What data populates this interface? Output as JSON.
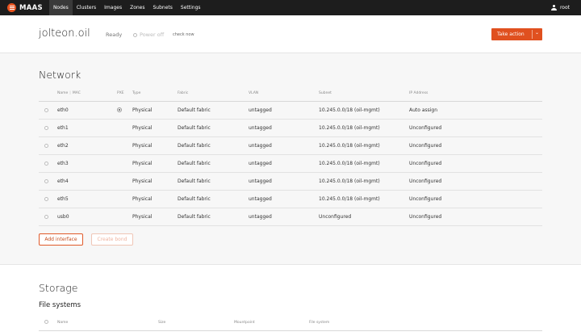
{
  "app": {
    "brand": "MAAS",
    "nav": [
      "Nodes",
      "Clusters",
      "Images",
      "Zones",
      "Subnets",
      "Settings"
    ],
    "active_nav": "Nodes",
    "user": "root"
  },
  "node": {
    "title": "jolteon.oil",
    "status": "Ready",
    "power": "Power off",
    "check_now": "check now",
    "take_action": "Take action"
  },
  "network": {
    "title": "Network",
    "headers": {
      "name": "Name",
      "mac": "MAC",
      "pxe": "PXE",
      "type": "Type",
      "fabric": "Fabric",
      "vlan": "VLAN",
      "subnet": "Subnet",
      "ip": "IP Address"
    },
    "rows": [
      {
        "name": "eth0",
        "pxe": true,
        "type": "Physical",
        "fabric": "Default fabric",
        "vlan": "untagged",
        "subnet": "10.245.0.0/18 (oil-mgmt)",
        "ip": "Auto assign"
      },
      {
        "name": "eth1",
        "pxe": false,
        "type": "Physical",
        "fabric": "Default fabric",
        "vlan": "untagged",
        "subnet": "10.245.0.0/18 (oil-mgmt)",
        "ip": "Unconfigured"
      },
      {
        "name": "eth2",
        "pxe": false,
        "type": "Physical",
        "fabric": "Default fabric",
        "vlan": "untagged",
        "subnet": "10.245.0.0/18 (oil-mgmt)",
        "ip": "Unconfigured"
      },
      {
        "name": "eth3",
        "pxe": false,
        "type": "Physical",
        "fabric": "Default fabric",
        "vlan": "untagged",
        "subnet": "10.245.0.0/18 (oil-mgmt)",
        "ip": "Unconfigured"
      },
      {
        "name": "eth4",
        "pxe": false,
        "type": "Physical",
        "fabric": "Default fabric",
        "vlan": "untagged",
        "subnet": "10.245.0.0/18 (oil-mgmt)",
        "ip": "Unconfigured"
      },
      {
        "name": "eth5",
        "pxe": false,
        "type": "Physical",
        "fabric": "Default fabric",
        "vlan": "untagged",
        "subnet": "10.245.0.0/18 (oil-mgmt)",
        "ip": "Unconfigured"
      },
      {
        "name": "usb0",
        "pxe": false,
        "type": "Physical",
        "fabric": "Default fabric",
        "vlan": "untagged",
        "subnet": "Unconfigured",
        "ip": "Unconfigured"
      }
    ],
    "add_interface": "Add interface",
    "create_bond": "Create bond"
  },
  "storage": {
    "title": "Storage",
    "fs_title": "File systems",
    "headers": {
      "name": "Name",
      "size": "Size",
      "mountpoint": "Mountpoint",
      "filesystem": "File system"
    }
  },
  "colors": {
    "accent": "#e95420",
    "nav_bg": "#1d1d1d"
  }
}
